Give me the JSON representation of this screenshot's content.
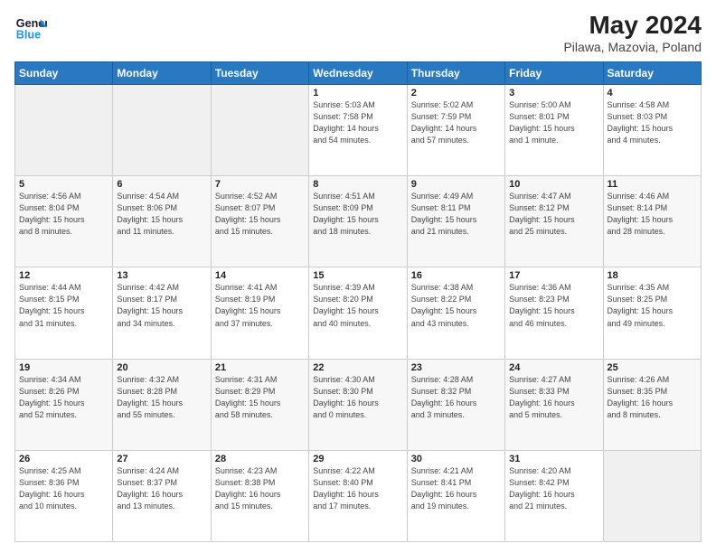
{
  "header": {
    "logo_line1": "General",
    "logo_line2": "Blue",
    "main_title": "May 2024",
    "subtitle": "Pilawa, Mazovia, Poland"
  },
  "weekdays": [
    "Sunday",
    "Monday",
    "Tuesday",
    "Wednesday",
    "Thursday",
    "Friday",
    "Saturday"
  ],
  "weeks": [
    [
      {
        "day": "",
        "info": ""
      },
      {
        "day": "",
        "info": ""
      },
      {
        "day": "",
        "info": ""
      },
      {
        "day": "1",
        "info": "Sunrise: 5:03 AM\nSunset: 7:58 PM\nDaylight: 14 hours\nand 54 minutes."
      },
      {
        "day": "2",
        "info": "Sunrise: 5:02 AM\nSunset: 7:59 PM\nDaylight: 14 hours\nand 57 minutes."
      },
      {
        "day": "3",
        "info": "Sunrise: 5:00 AM\nSunset: 8:01 PM\nDaylight: 15 hours\nand 1 minute."
      },
      {
        "day": "4",
        "info": "Sunrise: 4:58 AM\nSunset: 8:03 PM\nDaylight: 15 hours\nand 4 minutes."
      }
    ],
    [
      {
        "day": "5",
        "info": "Sunrise: 4:56 AM\nSunset: 8:04 PM\nDaylight: 15 hours\nand 8 minutes."
      },
      {
        "day": "6",
        "info": "Sunrise: 4:54 AM\nSunset: 8:06 PM\nDaylight: 15 hours\nand 11 minutes."
      },
      {
        "day": "7",
        "info": "Sunrise: 4:52 AM\nSunset: 8:07 PM\nDaylight: 15 hours\nand 15 minutes."
      },
      {
        "day": "8",
        "info": "Sunrise: 4:51 AM\nSunset: 8:09 PM\nDaylight: 15 hours\nand 18 minutes."
      },
      {
        "day": "9",
        "info": "Sunrise: 4:49 AM\nSunset: 8:11 PM\nDaylight: 15 hours\nand 21 minutes."
      },
      {
        "day": "10",
        "info": "Sunrise: 4:47 AM\nSunset: 8:12 PM\nDaylight: 15 hours\nand 25 minutes."
      },
      {
        "day": "11",
        "info": "Sunrise: 4:46 AM\nSunset: 8:14 PM\nDaylight: 15 hours\nand 28 minutes."
      }
    ],
    [
      {
        "day": "12",
        "info": "Sunrise: 4:44 AM\nSunset: 8:15 PM\nDaylight: 15 hours\nand 31 minutes."
      },
      {
        "day": "13",
        "info": "Sunrise: 4:42 AM\nSunset: 8:17 PM\nDaylight: 15 hours\nand 34 minutes."
      },
      {
        "day": "14",
        "info": "Sunrise: 4:41 AM\nSunset: 8:19 PM\nDaylight: 15 hours\nand 37 minutes."
      },
      {
        "day": "15",
        "info": "Sunrise: 4:39 AM\nSunset: 8:20 PM\nDaylight: 15 hours\nand 40 minutes."
      },
      {
        "day": "16",
        "info": "Sunrise: 4:38 AM\nSunset: 8:22 PM\nDaylight: 15 hours\nand 43 minutes."
      },
      {
        "day": "17",
        "info": "Sunrise: 4:36 AM\nSunset: 8:23 PM\nDaylight: 15 hours\nand 46 minutes."
      },
      {
        "day": "18",
        "info": "Sunrise: 4:35 AM\nSunset: 8:25 PM\nDaylight: 15 hours\nand 49 minutes."
      }
    ],
    [
      {
        "day": "19",
        "info": "Sunrise: 4:34 AM\nSunset: 8:26 PM\nDaylight: 15 hours\nand 52 minutes."
      },
      {
        "day": "20",
        "info": "Sunrise: 4:32 AM\nSunset: 8:28 PM\nDaylight: 15 hours\nand 55 minutes."
      },
      {
        "day": "21",
        "info": "Sunrise: 4:31 AM\nSunset: 8:29 PM\nDaylight: 15 hours\nand 58 minutes."
      },
      {
        "day": "22",
        "info": "Sunrise: 4:30 AM\nSunset: 8:30 PM\nDaylight: 16 hours\nand 0 minutes."
      },
      {
        "day": "23",
        "info": "Sunrise: 4:28 AM\nSunset: 8:32 PM\nDaylight: 16 hours\nand 3 minutes."
      },
      {
        "day": "24",
        "info": "Sunrise: 4:27 AM\nSunset: 8:33 PM\nDaylight: 16 hours\nand 5 minutes."
      },
      {
        "day": "25",
        "info": "Sunrise: 4:26 AM\nSunset: 8:35 PM\nDaylight: 16 hours\nand 8 minutes."
      }
    ],
    [
      {
        "day": "26",
        "info": "Sunrise: 4:25 AM\nSunset: 8:36 PM\nDaylight: 16 hours\nand 10 minutes."
      },
      {
        "day": "27",
        "info": "Sunrise: 4:24 AM\nSunset: 8:37 PM\nDaylight: 16 hours\nand 13 minutes."
      },
      {
        "day": "28",
        "info": "Sunrise: 4:23 AM\nSunset: 8:38 PM\nDaylight: 16 hours\nand 15 minutes."
      },
      {
        "day": "29",
        "info": "Sunrise: 4:22 AM\nSunset: 8:40 PM\nDaylight: 16 hours\nand 17 minutes."
      },
      {
        "day": "30",
        "info": "Sunrise: 4:21 AM\nSunset: 8:41 PM\nDaylight: 16 hours\nand 19 minutes."
      },
      {
        "day": "31",
        "info": "Sunrise: 4:20 AM\nSunset: 8:42 PM\nDaylight: 16 hours\nand 21 minutes."
      },
      {
        "day": "",
        "info": ""
      }
    ]
  ]
}
